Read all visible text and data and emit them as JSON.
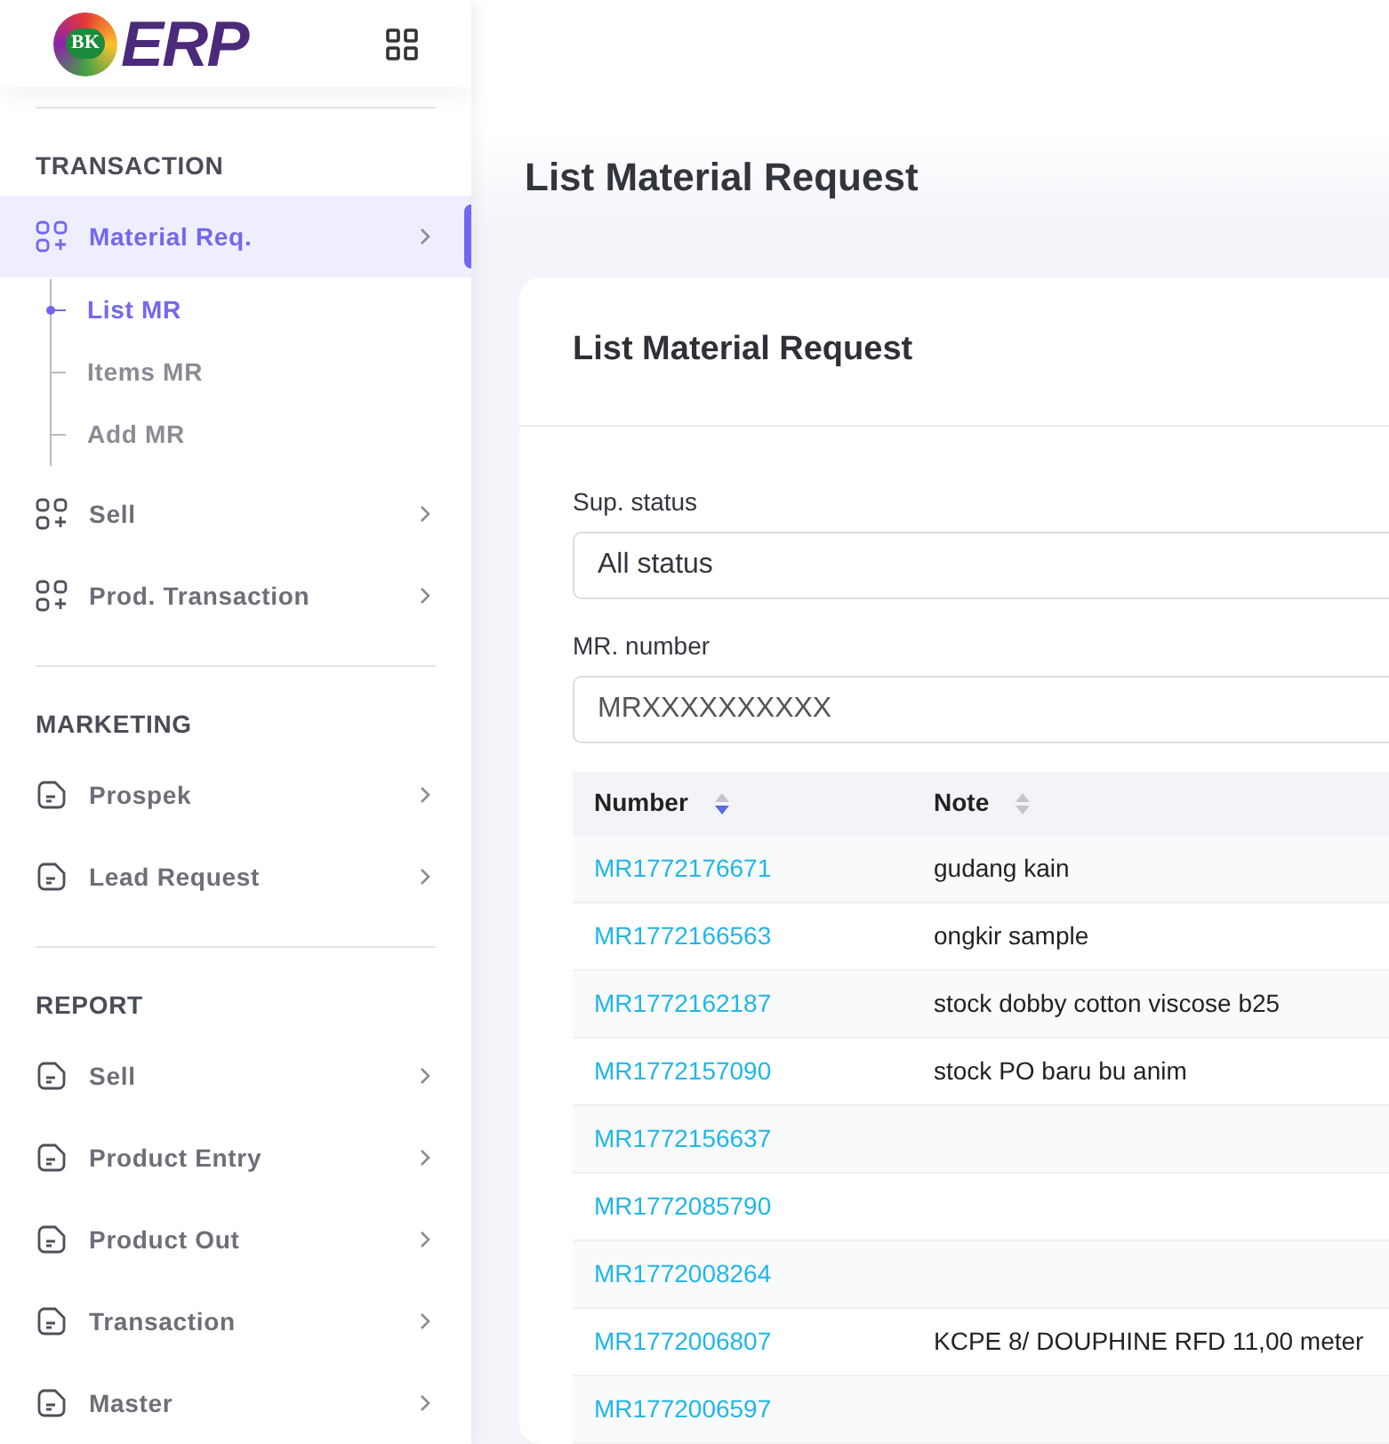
{
  "logo": {
    "badge": "BK",
    "text": "ERP"
  },
  "sidebar": {
    "sections": [
      {
        "title": "TRANSACTION",
        "items": [
          {
            "label": "Material Req.",
            "kind": "apps",
            "selected": true,
            "children": [
              {
                "label": "List MR",
                "selected": true
              },
              {
                "label": "Items MR",
                "selected": false
              },
              {
                "label": "Add MR",
                "selected": false
              }
            ]
          },
          {
            "label": "Sell",
            "kind": "apps",
            "selected": false
          },
          {
            "label": "Prod. Transaction",
            "kind": "apps",
            "selected": false
          }
        ]
      },
      {
        "title": "MARKETING",
        "items": [
          {
            "label": "Prospek",
            "kind": "note",
            "selected": false
          },
          {
            "label": "Lead Request",
            "kind": "note",
            "selected": false
          }
        ]
      },
      {
        "title": "REPORT",
        "items": [
          {
            "label": "Sell",
            "kind": "note",
            "selected": false
          },
          {
            "label": "Product Entry",
            "kind": "note",
            "selected": false
          },
          {
            "label": "Product Out",
            "kind": "note",
            "selected": false
          },
          {
            "label": "Transaction",
            "kind": "note",
            "selected": false
          },
          {
            "label": "Master",
            "kind": "note",
            "selected": false
          }
        ]
      }
    ]
  },
  "page_title": "List Material Request",
  "card": {
    "title": "List Material Request",
    "filters": [
      {
        "label": "Sup. status",
        "kind": "select",
        "value": "All status"
      },
      {
        "label": "MR. number",
        "kind": "input",
        "placeholder": "MRXXXXXXXXXX"
      }
    ],
    "table": {
      "columns": [
        {
          "label": "Number",
          "sorted": true
        },
        {
          "label": "Note",
          "sorted": false
        }
      ],
      "rows": [
        {
          "number": "MR1772176671",
          "note": "gudang kain"
        },
        {
          "number": "MR1772166563",
          "note": "ongkir sample"
        },
        {
          "number": "MR1772162187",
          "note": "stock dobby cotton viscose b25"
        },
        {
          "number": "MR1772157090",
          "note": "stock PO baru bu anim"
        },
        {
          "number": "MR1772156637"
        },
        {
          "number": "MR1772085790"
        },
        {
          "number": "MR1772008264"
        },
        {
          "number": "MR1772006807",
          "note": "KCPE 8/ DOUPHINE RFD 11,00 meter"
        },
        {
          "number": "MR1772006597"
        }
      ]
    }
  }
}
